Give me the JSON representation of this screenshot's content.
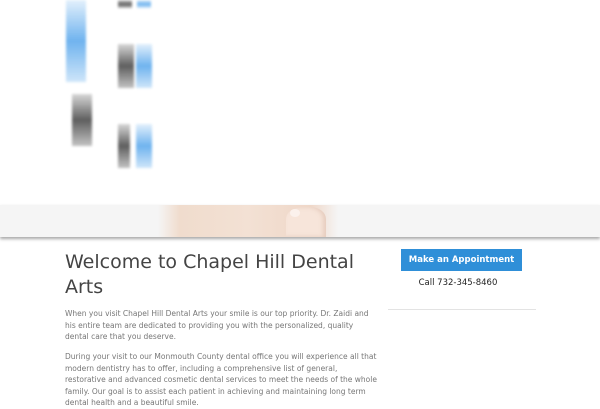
{
  "welcome": {
    "title": "Welcome to Chapel Hill Dental Arts",
    "paragraph1": "When you visit Chapel Hill Dental Arts your smile is our top priority. Dr. Zaidi and his entire team are dedicated to providing you with the personalized, quality dental care that you deserve.",
    "paragraph2": "During your visit to our Monmouth County dental office you will experience all that modern dentistry has to offer, including a comprehensive list of general, restorative and advanced cosmetic dental services to meet the needs of the whole family. Our goal is to assist each patient in achieving and maintaining long term dental health and a beautiful smile."
  },
  "sidebar": {
    "appointment_button": "Make an Appointment",
    "call_text": "Call 732-345-8460"
  },
  "colors": {
    "button": "#2f8fd8",
    "heading": "#444444",
    "body_text": "#777777"
  }
}
